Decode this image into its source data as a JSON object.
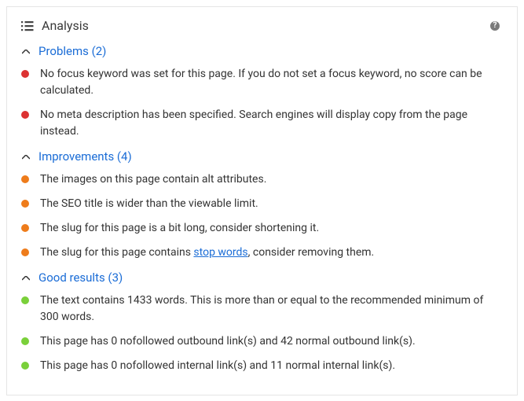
{
  "header": {
    "title": "Analysis"
  },
  "sections": [
    {
      "id": "problems",
      "label": "Problems",
      "count": 2,
      "color": "red",
      "items": [
        {
          "text": "No focus keyword was set for this page. If you do not set a focus keyword, no score can be calculated."
        },
        {
          "text": "No meta description has been specified. Search engines will display copy from the page instead."
        }
      ]
    },
    {
      "id": "improvements",
      "label": "Improvements",
      "count": 4,
      "color": "orange",
      "items": [
        {
          "text": "The images on this page contain alt attributes."
        },
        {
          "text": "The SEO title is wider than the viewable limit."
        },
        {
          "text": "The slug for this page is a bit long, consider shortening it."
        },
        {
          "text_pre": "The slug for this page contains ",
          "link_text": "stop words",
          "text_post": ", consider removing them."
        }
      ]
    },
    {
      "id": "good",
      "label": "Good results",
      "count": 3,
      "color": "green",
      "items": [
        {
          "text": "The text contains 1433 words. This is more than or equal to the recommended minimum of 300 words."
        },
        {
          "text": "This page has 0 nofollowed outbound link(s) and 42 normal outbound link(s)."
        },
        {
          "text": "This page has 0 nofollowed internal link(s) and 11 normal internal link(s)."
        }
      ]
    }
  ]
}
